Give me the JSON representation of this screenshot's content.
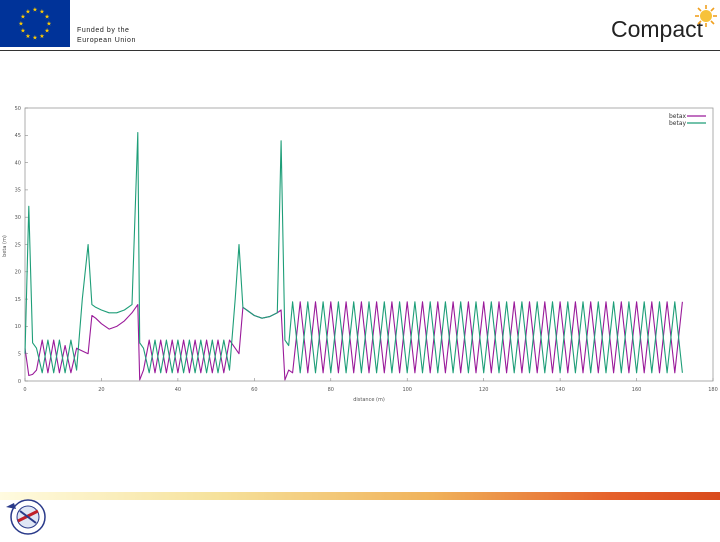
{
  "header": {
    "funding_line1": "Funded by the",
    "funding_line2": "European Union",
    "brand": "Compact"
  },
  "icons": {
    "flag": "eu-flag-icon",
    "sun": "sun-icon",
    "footer": "institution-logo-icon"
  },
  "colors": {
    "beta_x": "#9a1a9a",
    "beta_y": "#1e9e78",
    "eu_blue": "#003399",
    "eu_star": "#ffcc00"
  },
  "chart_data": {
    "type": "line",
    "xlabel": "distance (m)",
    "ylabel": "beta (m)",
    "xlim": [
      0,
      180
    ],
    "ylim": [
      0,
      50
    ],
    "x_ticks": [
      0,
      20,
      40,
      60,
      80,
      100,
      120,
      140,
      160,
      180
    ],
    "y_ticks": [
      0,
      5,
      10,
      15,
      20,
      25,
      30,
      35,
      40,
      45,
      50
    ],
    "legend_position": "top-right",
    "grid": false,
    "series": [
      {
        "name": "betax",
        "color": "#9a1a9a",
        "x": [
          0,
          1,
          2,
          3,
          4.5,
          6,
          7.5,
          9,
          10.5,
          12,
          13.5,
          15,
          16.5,
          17.5,
          18.5,
          20,
          22,
          24,
          26,
          28,
          29.5,
          30,
          31,
          32.5,
          34,
          35.5,
          37,
          38.5,
          40,
          41.5,
          43,
          44.5,
          46,
          47.5,
          49,
          50.5,
          52,
          53.5,
          55,
          56,
          57,
          58,
          60,
          62,
          64,
          66,
          67,
          68,
          69,
          70,
          72,
          74,
          76,
          78,
          80,
          82,
          84,
          86,
          88,
          90,
          92,
          94,
          96,
          98,
          100,
          102,
          104,
          106,
          108,
          110,
          112,
          114,
          116,
          118,
          120,
          122,
          124,
          126,
          128,
          130,
          132,
          134,
          136,
          138,
          140,
          142,
          144,
          146,
          148,
          150,
          152,
          154,
          156,
          158,
          160,
          162,
          164,
          166,
          168,
          170,
          172
        ],
        "y": [
          6,
          1,
          1.2,
          2,
          7.5,
          1.5,
          7.5,
          1.5,
          6.5,
          1.5,
          6,
          5.5,
          5,
          12,
          11.5,
          10.5,
          9.5,
          10,
          11,
          12.5,
          14,
          0.2,
          2,
          7.5,
          1.5,
          7.5,
          1.5,
          7.5,
          1.5,
          7.5,
          1.5,
          7.5,
          1.5,
          7.5,
          1.5,
          7.5,
          1.5,
          7.5,
          6,
          5,
          13.5,
          13,
          12,
          11.5,
          11.8,
          12.5,
          13,
          0.2,
          2,
          1.5,
          14.5,
          1.5,
          14.5,
          1.5,
          14.5,
          1.5,
          14.5,
          1.5,
          14.5,
          1.5,
          14.5,
          1.5,
          14.5,
          1.5,
          14.5,
          1.5,
          14.5,
          1.5,
          14.5,
          1.5,
          14.5,
          1.5,
          14.5,
          1.5,
          14.5,
          1.5,
          14.5,
          1.5,
          14.5,
          1.5,
          14.5,
          1.5,
          14.5,
          1.5,
          14.5,
          1.5,
          14.5,
          1.5,
          14.5,
          1.5,
          14.5,
          1.5,
          14.5,
          1.5,
          14.5,
          1.5,
          14.5,
          1.5,
          14.5,
          1.5,
          14.5
        ]
      },
      {
        "name": "betay",
        "color": "#1e9e78",
        "x": [
          0,
          1,
          2,
          3,
          4.5,
          6,
          7.5,
          9,
          10.5,
          12,
          13.5,
          15,
          16.5,
          17.5,
          18.5,
          20,
          22,
          24,
          26,
          28,
          29.5,
          30,
          31,
          32.5,
          34,
          35.5,
          37,
          38.5,
          40,
          41.5,
          43,
          44.5,
          46,
          47.5,
          49,
          50.5,
          52,
          53.5,
          55,
          56,
          57,
          58,
          60,
          62,
          64,
          66,
          67,
          68,
          69,
          70,
          72,
          74,
          76,
          78,
          80,
          82,
          84,
          86,
          88,
          90,
          92,
          94,
          96,
          98,
          100,
          102,
          104,
          106,
          108,
          110,
          112,
          114,
          116,
          118,
          120,
          122,
          124,
          126,
          128,
          130,
          132,
          134,
          136,
          138,
          140,
          142,
          144,
          146,
          148,
          150,
          152,
          154,
          156,
          158,
          160,
          162,
          164,
          166,
          168,
          170,
          172
        ],
        "y": [
          5,
          32,
          7,
          6,
          1.5,
          7.5,
          1.5,
          7.5,
          1.5,
          7.5,
          2,
          15,
          25,
          14,
          13.5,
          13,
          12.5,
          12.5,
          13,
          14,
          45.5,
          7,
          6,
          1.5,
          7.5,
          1.5,
          7.5,
          1.5,
          7.5,
          1.5,
          7.5,
          1.5,
          7.5,
          1.5,
          7.5,
          1.5,
          7.5,
          2,
          15,
          25,
          13.5,
          13,
          12,
          11.5,
          11.8,
          12.5,
          44,
          7.5,
          6.5,
          14.5,
          1.5,
          14.5,
          1.5,
          14.5,
          1.5,
          14.5,
          1.5,
          14.5,
          1.5,
          14.5,
          1.5,
          14.5,
          1.5,
          14.5,
          1.5,
          14.5,
          1.5,
          14.5,
          1.5,
          14.5,
          1.5,
          14.5,
          1.5,
          14.5,
          1.5,
          14.5,
          1.5,
          14.5,
          1.5,
          14.5,
          1.5,
          14.5,
          1.5,
          14.5,
          1.5,
          14.5,
          1.5,
          14.5,
          1.5,
          14.5,
          1.5,
          14.5,
          1.5,
          14.5,
          1.5,
          14.5,
          1.5,
          14.5,
          1.5,
          14.5,
          1.5
        ]
      }
    ]
  }
}
